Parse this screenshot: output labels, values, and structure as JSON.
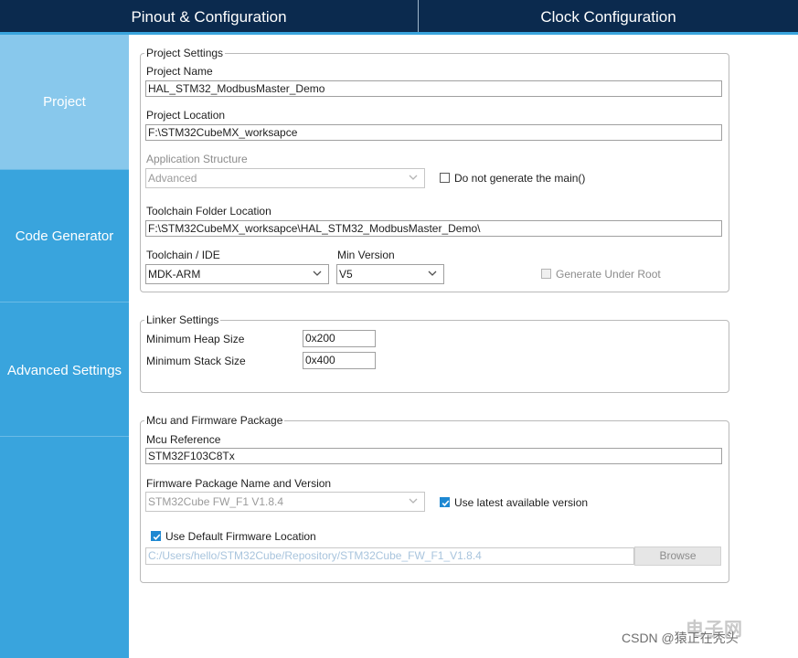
{
  "tabs": {
    "pinout": "Pinout & Configuration",
    "clock": "Clock Configuration"
  },
  "sidebar": {
    "items": [
      {
        "label": "Project"
      },
      {
        "label": "Code Generator"
      },
      {
        "label": "Advanced Settings"
      }
    ]
  },
  "project_settings": {
    "legend": "Project Settings",
    "name_label": "Project Name",
    "name_value": "HAL_STM32_ModbusMaster_Demo",
    "location_label": "Project Location",
    "location_value": "F:\\STM32CubeMX_worksapce",
    "app_structure_label": "Application Structure",
    "app_structure_value": "Advanced",
    "no_main_label": "Do not generate the main()",
    "no_main_checked": false,
    "toolchain_folder_label": "Toolchain Folder Location",
    "toolchain_folder_value": "F:\\STM32CubeMX_worksapce\\HAL_STM32_ModbusMaster_Demo\\",
    "toolchain_label": "Toolchain / IDE",
    "toolchain_value": "MDK-ARM",
    "min_version_label": "Min Version",
    "min_version_value": "V5",
    "gen_under_root_label": "Generate Under Root",
    "gen_under_root_checked": false
  },
  "linker_settings": {
    "legend": "Linker Settings",
    "heap_label": "Minimum Heap Size",
    "heap_value": "0x200",
    "stack_label": "Minimum Stack Size",
    "stack_value": "0x400"
  },
  "mcu_firmware": {
    "legend": "Mcu and Firmware Package",
    "mcu_ref_label": "Mcu Reference",
    "mcu_ref_value": "STM32F103C8Tx",
    "fw_pkg_label": "Firmware Package Name and Version",
    "fw_pkg_value": "STM32Cube FW_F1 V1.8.4",
    "use_latest_label": "Use latest available version",
    "use_latest_checked": true,
    "use_default_loc_label": "Use Default Firmware Location",
    "use_default_loc_checked": true,
    "fw_path_value": "C:/Users/hello/STM32Cube/Repository/STM32Cube_FW_F1_V1.8.4",
    "browse_label": "Browse"
  },
  "watermark": {
    "text": "CSDN @猿正在秃头",
    "logo": "电子网"
  },
  "colors": {
    "topbar": "#0b2a4e",
    "sidebar": "#39a4dd",
    "sidebar_active": "#88c8ec",
    "checkbox_on": "#1e88d2"
  }
}
